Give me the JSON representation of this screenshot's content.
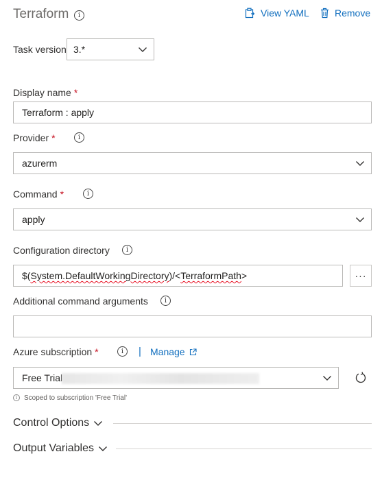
{
  "header": {
    "title": "Terraform",
    "view_yaml_label": "View YAML",
    "remove_label": "Remove"
  },
  "task_version": {
    "label": "Task version",
    "value": "3.*"
  },
  "display_name": {
    "label": "Display name",
    "required_mark": "*",
    "value": "Terraform : apply"
  },
  "provider": {
    "label": "Provider",
    "required_mark": "*",
    "value": "azurerm"
  },
  "command": {
    "label": "Command",
    "required_mark": "*",
    "value": "apply"
  },
  "configuration_directory": {
    "label": "Configuration directory",
    "value_prefix": "$(",
    "value_var": "System.DefaultWorkingDirectory",
    "value_mid": ")/<",
    "value_path": "TerraformPath",
    "value_suffix": ">",
    "browse_label": "···"
  },
  "additional_args": {
    "label": "Additional command arguments",
    "value": ""
  },
  "azure_subscription": {
    "label": "Azure subscription",
    "required_mark": "*",
    "separator": "|",
    "manage_label": "Manage",
    "value": "Free Trial",
    "hint": "Scoped to subscription 'Free Trial'"
  },
  "sections": {
    "control_options": "Control Options",
    "output_variables": "Output Variables"
  },
  "colors": {
    "link": "#106ebe",
    "required": "#c50f1f",
    "border": "#b9b8b6"
  }
}
